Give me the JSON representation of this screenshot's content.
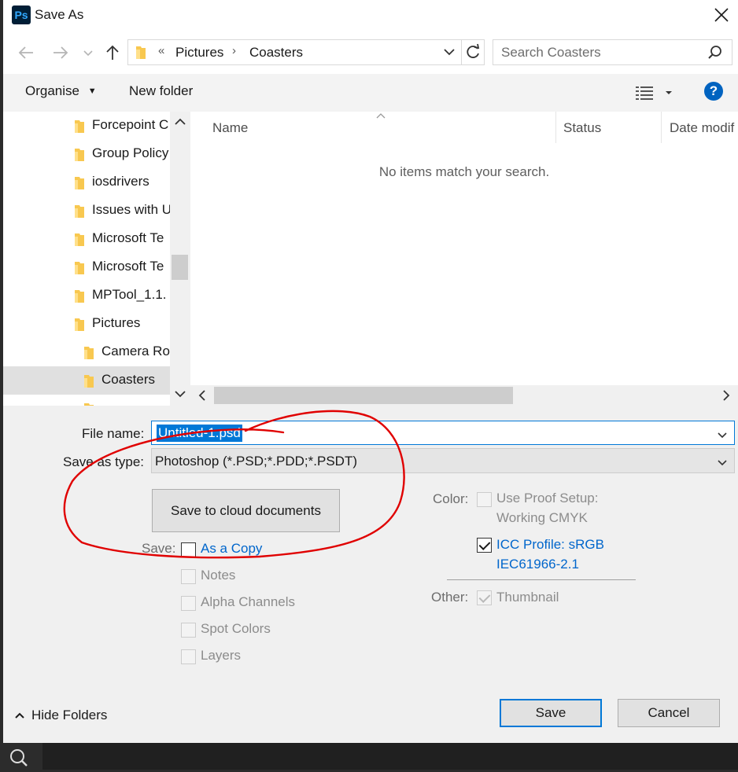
{
  "window": {
    "app_icon_text": "Ps",
    "title": "Save As"
  },
  "address": {
    "overflow_marker": "«",
    "crumbs": [
      "Pictures",
      "Coasters"
    ],
    "search_placeholder": "Search Coasters"
  },
  "toolbar": {
    "organise_label": "Organise",
    "new_folder_label": "New folder",
    "help_label": "?"
  },
  "tree": {
    "items": [
      {
        "label": "Forcepoint C",
        "selected": false
      },
      {
        "label": "Group Policy",
        "selected": false
      },
      {
        "label": "iosdrivers",
        "selected": false
      },
      {
        "label": "Issues with U",
        "selected": false
      },
      {
        "label": "Microsoft Te",
        "selected": false
      },
      {
        "label": "Microsoft Te",
        "selected": false
      },
      {
        "label": "MPTool_1.1.",
        "selected": false
      },
      {
        "label": "Pictures",
        "selected": false
      },
      {
        "label": "Camera Ro",
        "selected": false
      },
      {
        "label": "Coasters",
        "selected": true
      }
    ]
  },
  "list": {
    "columns": [
      "Name",
      "Status",
      "Date modif"
    ],
    "empty_message": "No items match your search."
  },
  "form": {
    "file_name_label": "File name:",
    "file_name_value": "Untitled-1.psd",
    "save_type_label": "Save as type:",
    "save_type_value": "Photoshop (*.PSD;*.PDD;*.PSDT)",
    "cloud_button": "Save to cloud documents",
    "save_label": "Save:",
    "save_options": [
      {
        "label": "As a Copy",
        "checked": false,
        "enabled": true
      },
      {
        "label": "Notes",
        "checked": false,
        "enabled": false
      },
      {
        "label": "Alpha Channels",
        "checked": false,
        "enabled": false
      },
      {
        "label": "Spot Colors",
        "checked": false,
        "enabled": false
      },
      {
        "label": "Layers",
        "checked": false,
        "enabled": false
      }
    ],
    "color_label": "Color:",
    "proof_setup_line1": "Use Proof Setup:",
    "proof_setup_line2": "Working CMYK",
    "proof_setup_checked": false,
    "icc_line1": "ICC Profile:  sRGB",
    "icc_line2": "IEC61966-2.1",
    "icc_checked": true,
    "other_label": "Other:",
    "thumbnail_label": "Thumbnail",
    "thumbnail_checked": true
  },
  "footer": {
    "hide_folders_label": "Hide Folders",
    "save_button": "Save",
    "cancel_button": "Cancel"
  },
  "colors": {
    "accent": "#0078d7",
    "annotation": "#e00000",
    "link": "#0066cc"
  }
}
